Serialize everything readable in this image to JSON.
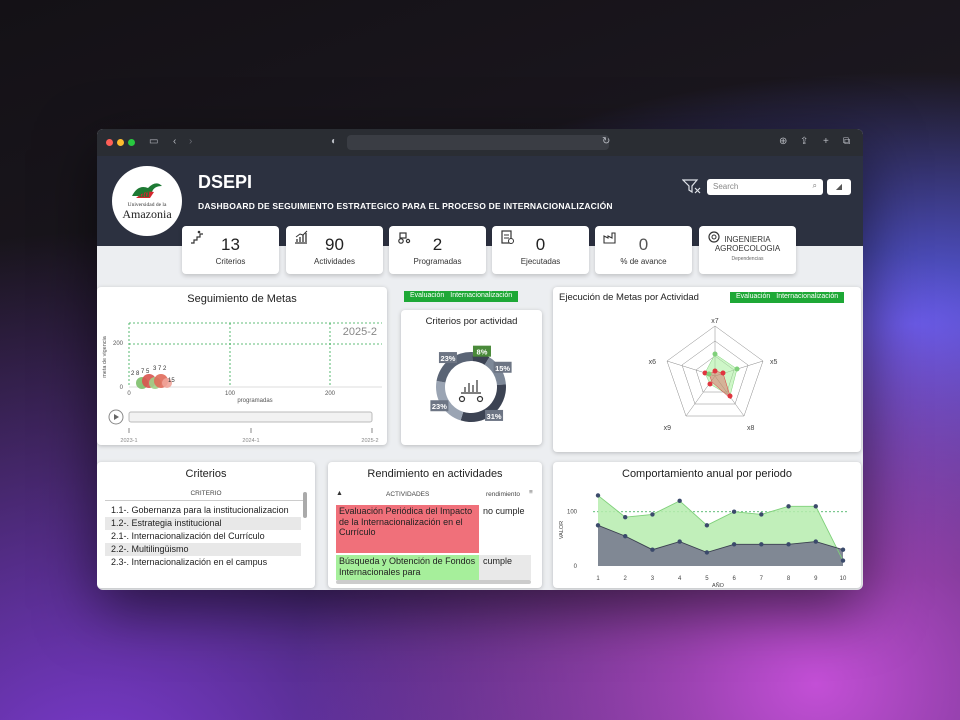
{
  "header": {
    "title": "DSEPI",
    "subtitle": "DASHBOARD DE SEGUIMIENTO ESTRATEGICO PARA EL PROCESO DE INTERNACIONALIZACIÓN",
    "logo_small": "Universidad de la",
    "logo_big": "Amazonia",
    "search_placeholder": "Search"
  },
  "kpis": [
    {
      "value": "13",
      "label": "Criterios",
      "icon": "stairs-icon"
    },
    {
      "value": "90",
      "label": "Actividades",
      "icon": "growth-chart-icon"
    },
    {
      "value": "2",
      "label": "Programadas",
      "icon": "tractor-icon"
    },
    {
      "value": "0",
      "label": "Ejecutadas",
      "icon": "checklist-icon"
    },
    {
      "value": "0",
      "label": "% de avance",
      "icon": "factory-icon"
    }
  ],
  "dependencia": {
    "line1": "INGENIERIA",
    "line2": "AGROECOLOGIA",
    "label": "Dependencias"
  },
  "seguimiento": {
    "title": "Seguimiento de Metas",
    "tags": [
      "Evaluación",
      "Internacionalización"
    ],
    "year_label": "2025-2",
    "ylabel": "meta de vigencia",
    "xlabel": "programadas",
    "yticks": [
      "200",
      "0"
    ],
    "xticks": [
      "0",
      "100",
      "200"
    ],
    "bubble_labels": [
      "2",
      "8",
      "7",
      "5",
      "3",
      "7",
      "2",
      "15"
    ],
    "timeline": [
      "2023-1",
      "2024-1",
      "2025-2"
    ]
  },
  "criterios_actividad": {
    "title": "Criterios por actividad",
    "chart_data": {
      "type": "pie",
      "labels": [
        "8%",
        "15%",
        "31%",
        "23%",
        "23%"
      ],
      "values": [
        8,
        15,
        31,
        23,
        23
      ]
    }
  },
  "ejecucion": {
    "title": "Ejecución de Metas por Actividad",
    "tags": [
      "Evaluación",
      "Internacionalización"
    ],
    "axes": [
      "x7",
      "x5",
      "x8",
      "x9",
      "x6"
    ]
  },
  "criterios": {
    "title": "Criterios",
    "column": "CRITERIO",
    "items": [
      "1.1-. Gobernanza para la institucionalizacion",
      "1.2-. Estrategia institucional",
      "2.1-. Internacionalización del Currículo",
      "2.2-. Multilingüismo",
      "2.3-. Internacionalización en el campus"
    ]
  },
  "rendimiento": {
    "title": "Rendimiento en actividades",
    "col_activities": "ACTIVIDADES",
    "col_rendimiento": "rendimiento",
    "rows": [
      {
        "actividad": "Evaluación Periódica del Impacto de la Internacionalización en el Currículo",
        "rendimiento": "no cumple",
        "status_color": "#f0707a"
      },
      {
        "actividad": "Búsqueda y Obtención de Fondos Internacionales para",
        "rendimiento": "cumple",
        "status_color": "#a6ef9b"
      }
    ]
  },
  "comportamiento": {
    "title": "Comportamiento anual por periodo",
    "chart_data": {
      "type": "area",
      "x": [
        1,
        2,
        3,
        4,
        5,
        6,
        7,
        8,
        9,
        10
      ],
      "series": [
        {
          "values": [
            130,
            90,
            95,
            120,
            75,
            100,
            95,
            110,
            110,
            10
          ]
        },
        {
          "values": [
            75,
            55,
            30,
            45,
            25,
            40,
            40,
            40,
            45,
            30
          ]
        }
      ],
      "xlabel": "AÑO",
      "ylabel": "VALOR",
      "yticks": [
        "100",
        "0"
      ],
      "ylim": [
        0,
        140
      ]
    }
  },
  "colors": {
    "accent_green": "#1ea836",
    "header_bg": "#2c3140",
    "red": "#e0353f"
  }
}
